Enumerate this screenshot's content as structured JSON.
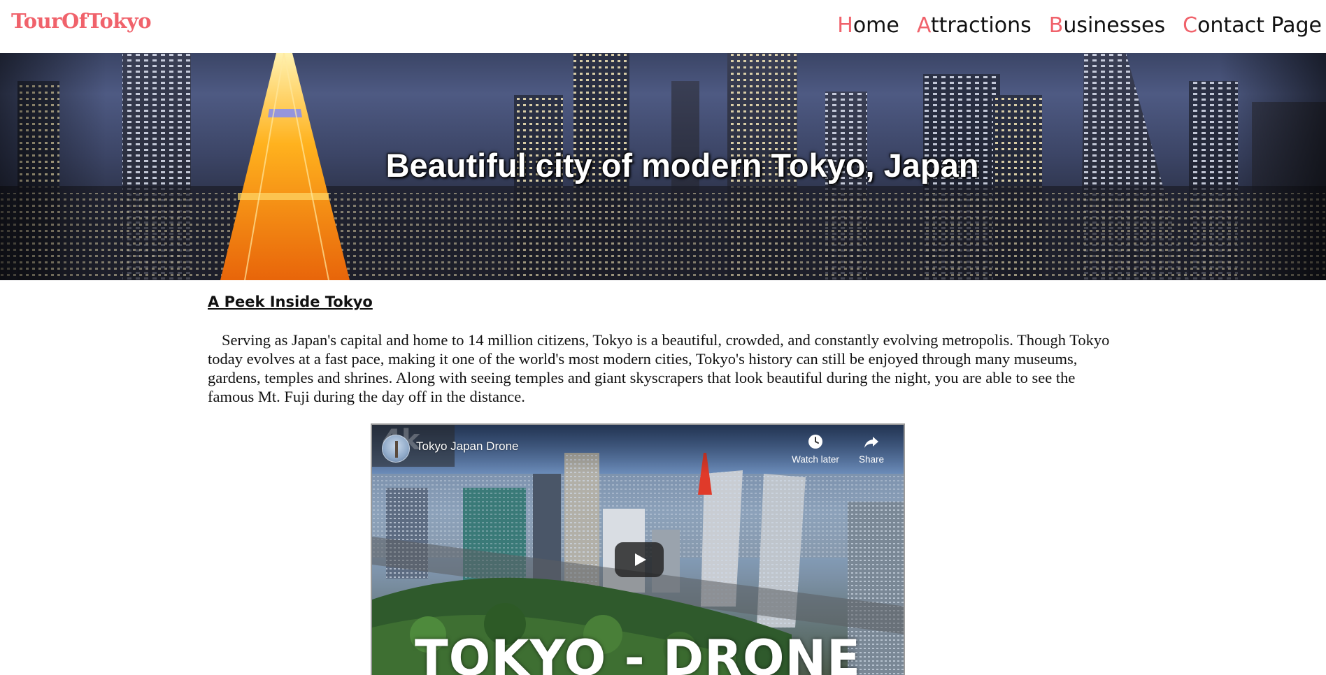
{
  "header": {
    "brand": "TourOfTokyo",
    "nav": [
      {
        "first": "H",
        "rest": "ome"
      },
      {
        "first": "A",
        "rest": "ttractions"
      },
      {
        "first": "B",
        "rest": "usinesses"
      },
      {
        "first": "C",
        "rest": "ontact Page"
      }
    ]
  },
  "hero": {
    "title": "Beautiful city of modern Tokyo, Japan"
  },
  "main": {
    "heading": "A Peek Inside Tokyo",
    "intro": "Serving as Japan's capital and home to 14 million citizens, Tokyo is a beautiful, crowded, and constantly evolving metropolis. Though Tokyo today evolves at a fast pace, making it one of the world's most modern cities, Tokyo's history can still be enjoyed through many museums, gardens, temples and shrines. Along with seeing temples and giant skyscrapers that look beautiful during the night, you are able to see the famous Mt. Fuji during the day off in the distance."
  },
  "video": {
    "badge": "4k",
    "title": "Tokyo Japan Drone",
    "watch_later_label": "Watch later",
    "share_label": "Share",
    "overlay_text": "TOKYO - DRONE"
  },
  "colors": {
    "accent": "#f0626b",
    "text": "#111111"
  }
}
